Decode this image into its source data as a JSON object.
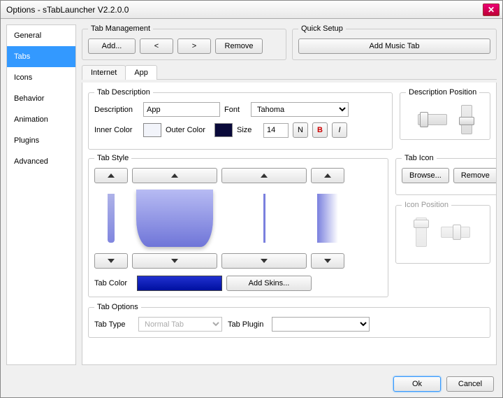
{
  "window": {
    "title": "Options - sTabLauncher V2.2.0.0"
  },
  "sidebar": {
    "items": [
      {
        "label": "General"
      },
      {
        "label": "Tabs"
      },
      {
        "label": "Icons"
      },
      {
        "label": "Behavior"
      },
      {
        "label": "Animation"
      },
      {
        "label": "Plugins"
      },
      {
        "label": "Advanced"
      }
    ],
    "selected_index": 1
  },
  "tab_mgmt": {
    "legend": "Tab Management",
    "add": "Add...",
    "prev": "<",
    "next": ">",
    "remove": "Remove"
  },
  "quick": {
    "legend": "Quick Setup",
    "add_music": "Add Music Tab"
  },
  "tabs": {
    "internet": "Internet",
    "app": "App",
    "active": "App"
  },
  "desc": {
    "legend": "Tab Description",
    "desc_label": "Description",
    "desc_value": "App",
    "font_label": "Font",
    "font_value": "Tahoma",
    "inner_label": "Inner Color",
    "inner_color": "#f2f4fa",
    "outer_label": "Outer Color",
    "outer_color": "#0a0a3a",
    "size_label": "Size",
    "size_value": "14",
    "fmt_n": "N",
    "fmt_b": "B",
    "fmt_i": "I",
    "pos_legend": "Description Position"
  },
  "style": {
    "legend": "Tab Style",
    "tabcolor_label": "Tab Color",
    "tabcolor": "#1522c4",
    "addskins": "Add Skins..."
  },
  "tabicon": {
    "legend": "Tab Icon",
    "browse": "Browse...",
    "remove": "Remove",
    "pos_legend": "Icon Position"
  },
  "options": {
    "legend": "Tab Options",
    "type_label": "Tab Type",
    "type_value": "Normal Tab",
    "plugin_label": "Tab Plugin",
    "plugin_value": ""
  },
  "footer": {
    "ok": "Ok",
    "cancel": "Cancel"
  }
}
